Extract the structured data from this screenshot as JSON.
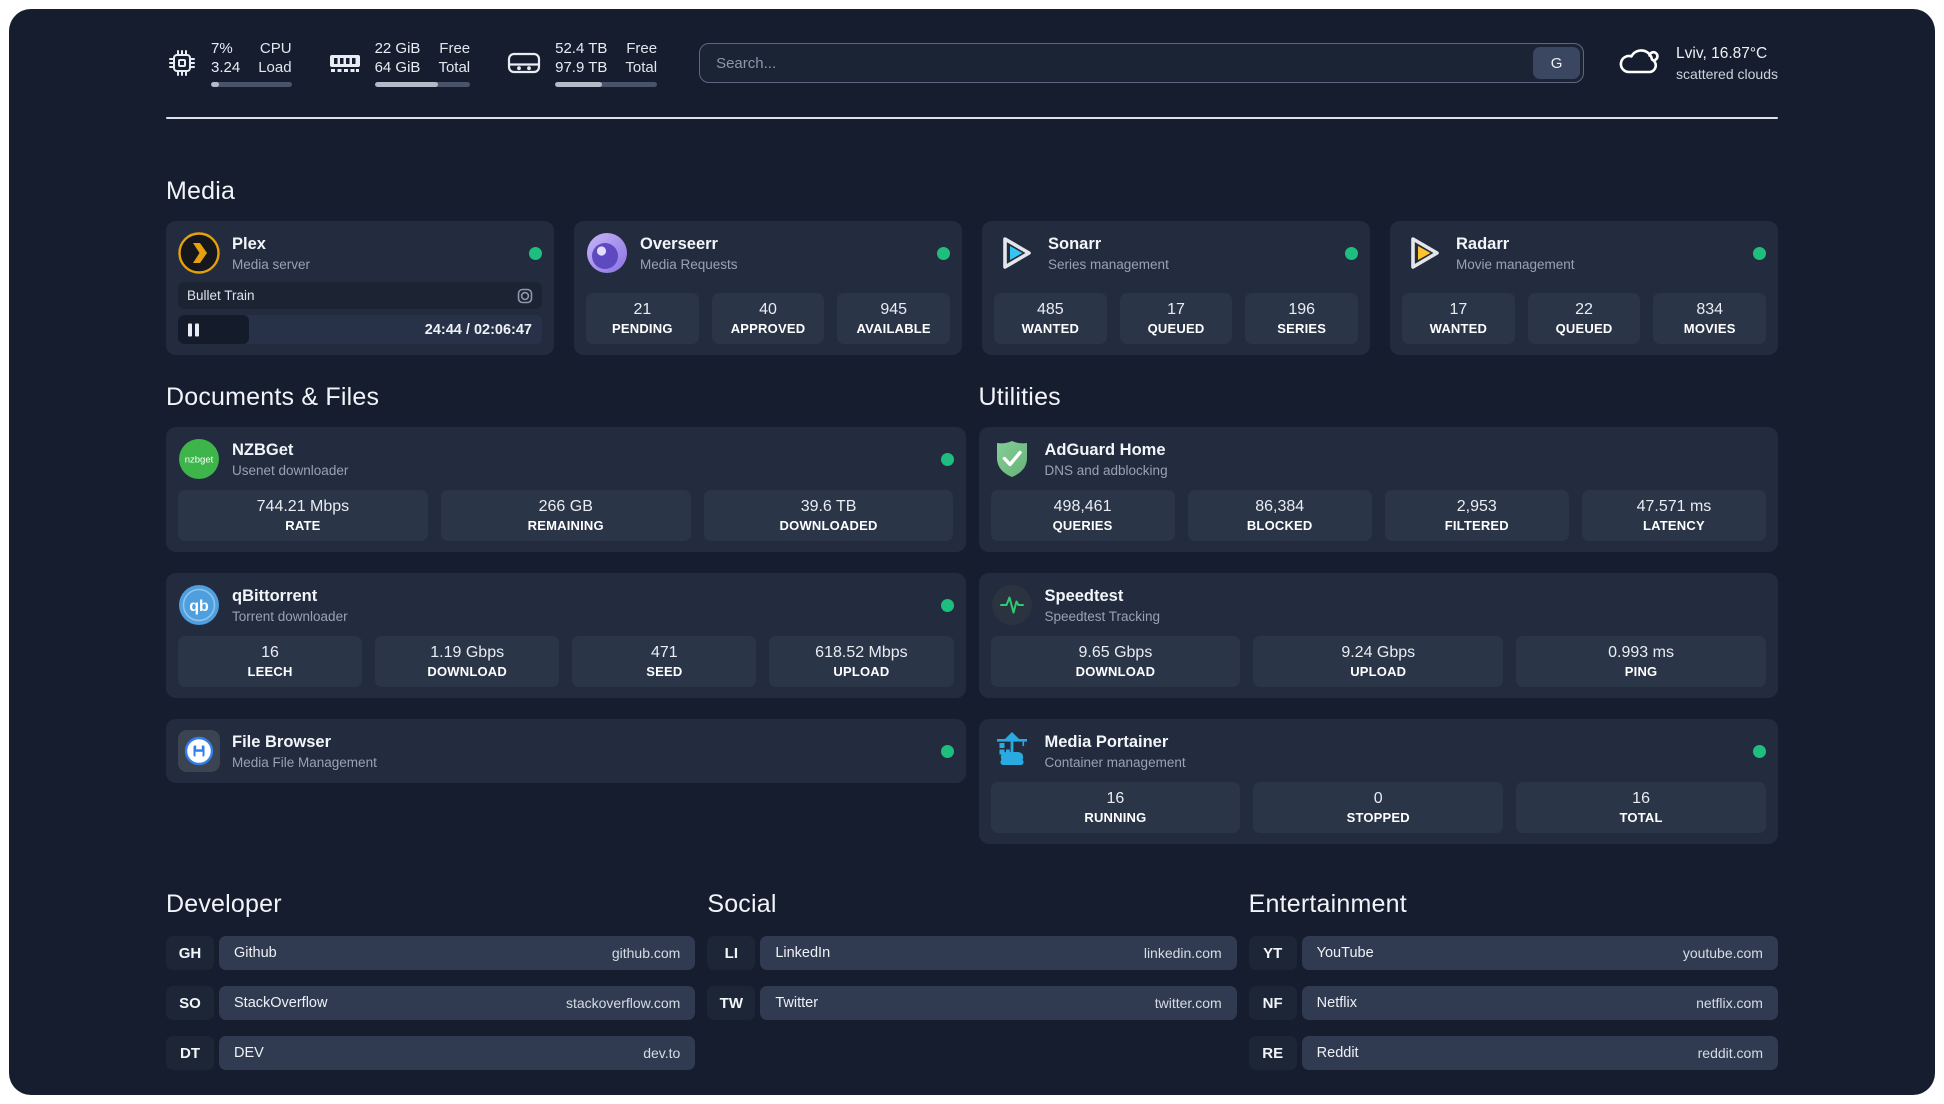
{
  "colors": {
    "status-green": "#1dbe7e",
    "accent-plex": "#e5a00d",
    "accent-overseerr": "#8a72e3",
    "accent-sonarr": "#35c5f4",
    "accent-radarr": "#ffc230",
    "accent-nzbget": "#3db54a",
    "accent-qbittorrent": "#4f9edd",
    "accent-adguard": "#67b279",
    "accent-speedtest": "#2ecc71",
    "accent-filebrowser": "#2f80ed",
    "accent-portainer": "#29abe2"
  },
  "system": {
    "cpu": {
      "value1": "7%",
      "value2": "3.24",
      "label1": "CPU",
      "label2": "Load",
      "bar_percent": 10
    },
    "memory": {
      "value1": "22 GiB",
      "value2": "64 GiB",
      "label1": "Free",
      "label2": "Total",
      "bar_percent": 66
    },
    "storage": {
      "value1": "52.4 TB",
      "value2": "97.9 TB",
      "label1": "Free",
      "label2": "Total",
      "bar_percent": 46
    }
  },
  "search": {
    "placeholder": "Search...",
    "engine_button": "G"
  },
  "weather": {
    "headline": "Lviv, 16.87°C",
    "condition": "scattered clouds"
  },
  "sections": {
    "media": {
      "title": "Media",
      "plex": {
        "name": "Plex",
        "description": "Media server",
        "player": {
          "title": "Bullet Train",
          "time": "24:44 / 02:06:47",
          "progress_percent": 19.5
        }
      },
      "overseerr": {
        "name": "Overseerr",
        "description": "Media Requests",
        "stats": [
          {
            "value": "21",
            "label": "PENDING"
          },
          {
            "value": "40",
            "label": "APPROVED"
          },
          {
            "value": "945",
            "label": "AVAILABLE"
          }
        ]
      },
      "sonarr": {
        "name": "Sonarr",
        "description": "Series management",
        "stats": [
          {
            "value": "485",
            "label": "WANTED"
          },
          {
            "value": "17",
            "label": "QUEUED"
          },
          {
            "value": "196",
            "label": "SERIES"
          }
        ]
      },
      "radarr": {
        "name": "Radarr",
        "description": "Movie management",
        "stats": [
          {
            "value": "17",
            "label": "WANTED"
          },
          {
            "value": "22",
            "label": "QUEUED"
          },
          {
            "value": "834",
            "label": "MOVIES"
          }
        ]
      }
    },
    "documents": {
      "title": "Documents & Files",
      "nzbget": {
        "name": "NZBGet",
        "description": "Usenet downloader",
        "icon_text": "nzbget",
        "stats": [
          {
            "value": "744.21 Mbps",
            "label": "RATE"
          },
          {
            "value": "266 GB",
            "label": "REMAINING"
          },
          {
            "value": "39.6 TB",
            "label": "DOWNLOADED"
          }
        ]
      },
      "qbittorrent": {
        "name": "qBittorrent",
        "description": "Torrent downloader",
        "icon_text": "qb",
        "stats": [
          {
            "value": "16",
            "label": "LEECH"
          },
          {
            "value": "1.19 Gbps",
            "label": "DOWNLOAD"
          },
          {
            "value": "471",
            "label": "SEED"
          },
          {
            "value": "618.52 Mbps",
            "label": "UPLOAD"
          }
        ]
      },
      "filebrowser": {
        "name": "File Browser",
        "description": "Media File Management"
      }
    },
    "utilities": {
      "title": "Utilities",
      "adguard": {
        "name": "AdGuard Home",
        "description": "DNS and adblocking",
        "stats": [
          {
            "value": "498,461",
            "label": "QUERIES"
          },
          {
            "value": "86,384",
            "label": "BLOCKED"
          },
          {
            "value": "2,953",
            "label": "FILTERED"
          },
          {
            "value": "47.571 ms",
            "label": "LATENCY"
          }
        ]
      },
      "speedtest": {
        "name": "Speedtest",
        "description": "Speedtest Tracking",
        "stats": [
          {
            "value": "9.65 Gbps",
            "label": "DOWNLOAD"
          },
          {
            "value": "9.24 Gbps",
            "label": "UPLOAD"
          },
          {
            "value": "0.993 ms",
            "label": "PING"
          }
        ]
      },
      "portainer": {
        "name": "Media Portainer",
        "description": "Container management",
        "stats": [
          {
            "value": "16",
            "label": "RUNNING"
          },
          {
            "value": "0",
            "label": "STOPPED"
          },
          {
            "value": "16",
            "label": "TOTAL"
          }
        ]
      }
    },
    "developer": {
      "title": "Developer",
      "links": [
        {
          "abbr": "GH",
          "name": "Github",
          "url": "github.com"
        },
        {
          "abbr": "SO",
          "name": "StackOverflow",
          "url": "stackoverflow.com"
        },
        {
          "abbr": "DT",
          "name": "DEV",
          "url": "dev.to"
        }
      ]
    },
    "social": {
      "title": "Social",
      "links": [
        {
          "abbr": "LI",
          "name": "LinkedIn",
          "url": "linkedin.com"
        },
        {
          "abbr": "TW",
          "name": "Twitter",
          "url": "twitter.com"
        }
      ]
    },
    "entertainment": {
      "title": "Entertainment",
      "links": [
        {
          "abbr": "YT",
          "name": "YouTube",
          "url": "youtube.com"
        },
        {
          "abbr": "NF",
          "name": "Netflix",
          "url": "netflix.com"
        },
        {
          "abbr": "RE",
          "name": "Reddit",
          "url": "reddit.com"
        }
      ]
    }
  }
}
